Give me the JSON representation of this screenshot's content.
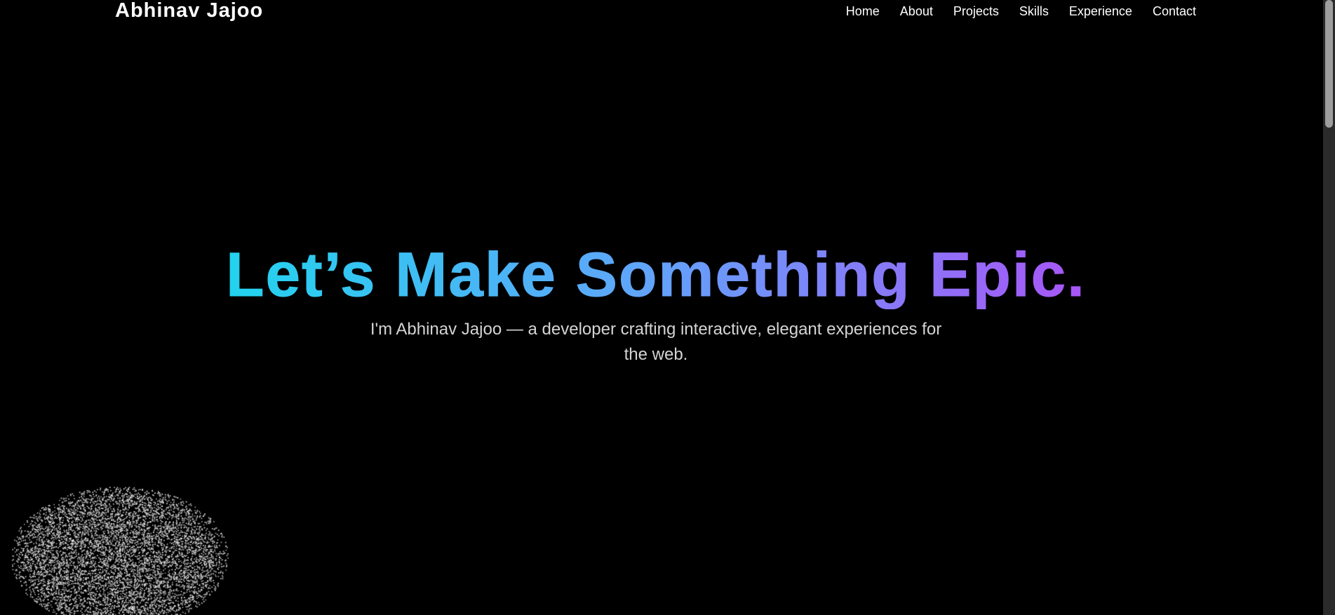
{
  "header": {
    "brand": "Abhinav Jajoo",
    "nav": [
      {
        "label": "Home"
      },
      {
        "label": "About"
      },
      {
        "label": "Projects"
      },
      {
        "label": "Skills"
      },
      {
        "label": "Experience"
      },
      {
        "label": "Contact"
      }
    ]
  },
  "hero": {
    "title": "Let’s Make Something Epic.",
    "subtitle": "I'm Abhinav Jajoo — a developer crafting interactive, elegant experiences for the web."
  },
  "theme": {
    "background": "#000000",
    "gradient_start": "#22d3ee",
    "gradient_mid": "#60a5fa",
    "gradient_end": "#a855f7",
    "text_primary": "#ffffff",
    "text_secondary": "#d4d4d4",
    "scrollbar_track": "#2b2b2b",
    "scrollbar_thumb": "#9e9e9e"
  },
  "decoration": {
    "particle_blob": "particle-field-graphic"
  }
}
